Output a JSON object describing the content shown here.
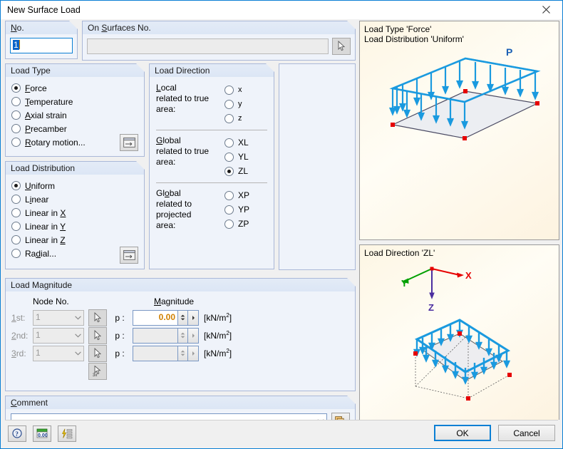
{
  "window": {
    "title": "New Surface Load",
    "close_icon": "close-icon"
  },
  "no_field": {
    "label": "No.",
    "accel": "N",
    "value": "1"
  },
  "surfaces_field": {
    "label": "On Surfaces No.",
    "accel": "S",
    "value": "",
    "pick_icon": "pick-cursor-icon"
  },
  "load_type": {
    "title": "Load Type",
    "options": [
      {
        "label": "Force",
        "accel": "F",
        "selected": true
      },
      {
        "label": "Temperature",
        "accel": "T",
        "selected": false
      },
      {
        "label": "Axial strain",
        "accel": "A",
        "selected": false
      },
      {
        "label": "Precamber",
        "accel": "P",
        "selected": false
      },
      {
        "label": "Rotary motion...",
        "accel": "R",
        "selected": false
      }
    ],
    "dialog_button_icon": "dialog-window-icon"
  },
  "load_distribution": {
    "title": "Load Distribution",
    "options": [
      {
        "label": "Uniform",
        "accel": "U",
        "selected": true
      },
      {
        "label": "Linear",
        "accel": "i",
        "selected": false
      },
      {
        "label": "Linear in X",
        "accel": "X",
        "selected": false
      },
      {
        "label": "Linear in Y",
        "accel": "Y",
        "selected": false
      },
      {
        "label": "Linear in Z",
        "accel": "Z",
        "selected": false
      },
      {
        "label": "Radial...",
        "accel": "d",
        "selected": false
      }
    ],
    "dialog_button_icon": "dialog-window-icon"
  },
  "load_direction": {
    "title": "Load Direction",
    "groups": [
      {
        "caption_line1": "Local",
        "caption_line2": "related to true area:",
        "accel": "L",
        "options": [
          {
            "label": "x",
            "selected": false
          },
          {
            "label": "y",
            "selected": false
          },
          {
            "label": "z",
            "selected": false
          }
        ]
      },
      {
        "caption_line1": "Global",
        "caption_line2": "related to true area:",
        "accel": "G",
        "options": [
          {
            "label": "XL",
            "selected": false
          },
          {
            "label": "YL",
            "selected": false
          },
          {
            "label": "ZL",
            "selected": true
          }
        ]
      },
      {
        "caption_line1": "Global",
        "caption_line2": "related to projected",
        "caption_line3": "area:",
        "accel": "o",
        "options": [
          {
            "label": "XP",
            "selected": false
          },
          {
            "label": "YP",
            "selected": false
          },
          {
            "label": "ZP",
            "selected": false
          }
        ]
      }
    ]
  },
  "load_magnitude": {
    "title": "Load Magnitude",
    "col_node": "Node No.",
    "col_magnitude": "Magnitude",
    "magnitude_accel": "M",
    "unit": "[kN/m",
    "unit_exp": "2",
    "unit_close": "]",
    "rows": [
      {
        "ordinal": "1st:",
        "ordinal_accel": "1",
        "node_value": "1",
        "p_label": "p :",
        "magnitude": "0.00",
        "enabled": true,
        "pick_icon": "pick-cursor-icon"
      },
      {
        "ordinal": "2nd:",
        "ordinal_accel": "2",
        "node_value": "1",
        "p_label": "p :",
        "magnitude": "",
        "enabled": false,
        "pick_icon": "pick-cursor-icon"
      },
      {
        "ordinal": "3rd:",
        "ordinal_accel": "3",
        "node_value": "1",
        "p_label": "p :",
        "magnitude": "",
        "enabled": false,
        "pick_icon": "pick-cursor-icon"
      }
    ],
    "pick3_icon": "pick-three-nodes-icon",
    "pick3_label": "3x"
  },
  "comment": {
    "title": "Comment",
    "accel": "C",
    "value": "",
    "copy_icon": "copy-comments-icon",
    "dropdown_icon": "chevron-down-icon"
  },
  "toolbar": [
    {
      "name": "help-icon",
      "label": "?"
    },
    {
      "name": "units-icon",
      "label": "0.00"
    },
    {
      "name": "quick-settings-icon",
      "label": ""
    }
  ],
  "buttons": {
    "ok": "OK",
    "cancel": "Cancel"
  },
  "preview_top": {
    "line1": "Load Type 'Force'",
    "line2": "Load Distribution 'Uniform'",
    "load_symbol": "P"
  },
  "preview_bottom": {
    "caption": "Load Direction 'ZL'",
    "axis_x": "X",
    "axis_y": "Y",
    "axis_z": "Z"
  },
  "colors": {
    "accent": "#0a7fd4",
    "member": "#1a9adf",
    "node": "#e60000",
    "axis_x": "#e60000",
    "axis_y": "#00a000",
    "axis_z": "#4b2ea0",
    "value_text": "#d08000"
  }
}
